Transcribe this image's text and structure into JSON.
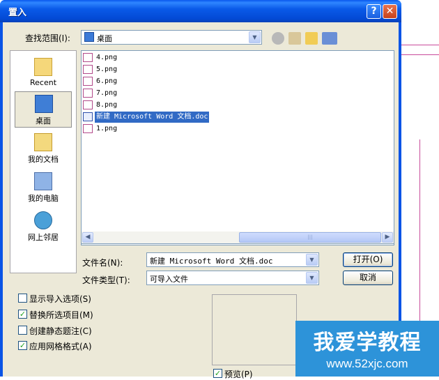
{
  "window": {
    "title": "置入",
    "help_glyph": "?",
    "close_glyph": "✕"
  },
  "lookin": {
    "label": "查找范围(I):",
    "value": "桌面"
  },
  "places": [
    {
      "label": "Recent",
      "icon": "folder-icon"
    },
    {
      "label": "桌面",
      "icon": "desktop-icon",
      "selected": true
    },
    {
      "label": "我的文档",
      "icon": "my-documents-icon"
    },
    {
      "label": "我的电脑",
      "icon": "my-computer-icon"
    },
    {
      "label": "网上邻居",
      "icon": "network-icon"
    }
  ],
  "files": [
    {
      "name": "4.png",
      "type": "png"
    },
    {
      "name": "5.png",
      "type": "png"
    },
    {
      "name": "6.png",
      "type": "png"
    },
    {
      "name": "7.png",
      "type": "png"
    },
    {
      "name": "8.png",
      "type": "png"
    },
    {
      "name": "新建 Microsoft Word 文档.doc",
      "type": "doc",
      "selected": true
    },
    {
      "name": "1.png",
      "type": "png"
    }
  ],
  "filename": {
    "label": "文件名(N):",
    "value": "新建 Microsoft Word 文档.doc"
  },
  "filetype": {
    "label": "文件类型(T):",
    "value": "可导入文件"
  },
  "buttons": {
    "open": "打开(O)",
    "cancel": "取消"
  },
  "options": [
    {
      "label": "显示导入选项(S)",
      "checked": false
    },
    {
      "label": "替换所选项目(M)",
      "checked": true
    },
    {
      "label": "创建静态题注(C)",
      "checked": false
    },
    {
      "label": "应用网格格式(A)",
      "checked": true
    }
  ],
  "preview": {
    "label": "预览(P)",
    "checked": true
  },
  "watermark": {
    "title": "我爱学教程",
    "url": "www.52xjc.com"
  },
  "colors": {
    "titlebar": "#0a54e6",
    "selection": "#316ac5",
    "face": "#ece9d8",
    "watermark": "#2d93d9"
  }
}
